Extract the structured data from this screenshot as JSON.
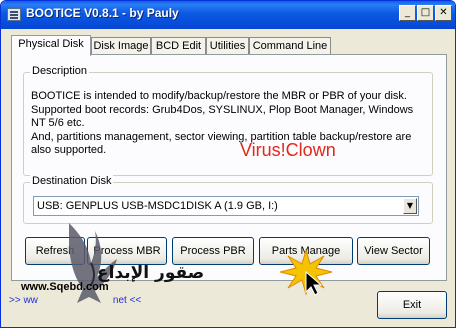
{
  "window": {
    "title": "BOOTICE V0.8.1 - by Pauly",
    "minimize_glyph": "_",
    "maximize_glyph": "□",
    "close_glyph": "✕"
  },
  "tabs": [
    {
      "label": "Physical Disk",
      "active": true
    },
    {
      "label": "Disk Image"
    },
    {
      "label": "BCD Edit"
    },
    {
      "label": "Utilities"
    },
    {
      "label": "Command Line"
    }
  ],
  "description": {
    "legend": "Description",
    "lines": [
      "BOOTICE is intended to modify/backup/restore the MBR or PBR of your disk.",
      "Supported boot records: Grub4Dos, SYSLINUX, Plop Boot Manager, Windows",
      "NT 5/6 etc.",
      "And, partitions management, sector viewing, partition table backup/restore are",
      "also supported."
    ]
  },
  "watermark_text": "Virus!Clown",
  "destination": {
    "legend": "Destination Disk",
    "selected": "USB: GENPLUS USB-MSDC1DISK A (1.9 GB, I:)"
  },
  "buttons": {
    "refresh": "Refresh",
    "process_mbr": "Process MBR",
    "process_pbr": "Process PBR",
    "parts_manage": "Parts Manage",
    "view_sector": "View Sector",
    "exit": "Exit"
  },
  "overlay": {
    "arabic_text": "صقور الإبداع",
    "site_text": "www.Sqebd.com",
    "link_text": ">> ww                           net <<"
  },
  "colors": {
    "titlebar": "#0a5fe8",
    "watermark": "#e0281c",
    "link": "#2030d8"
  }
}
